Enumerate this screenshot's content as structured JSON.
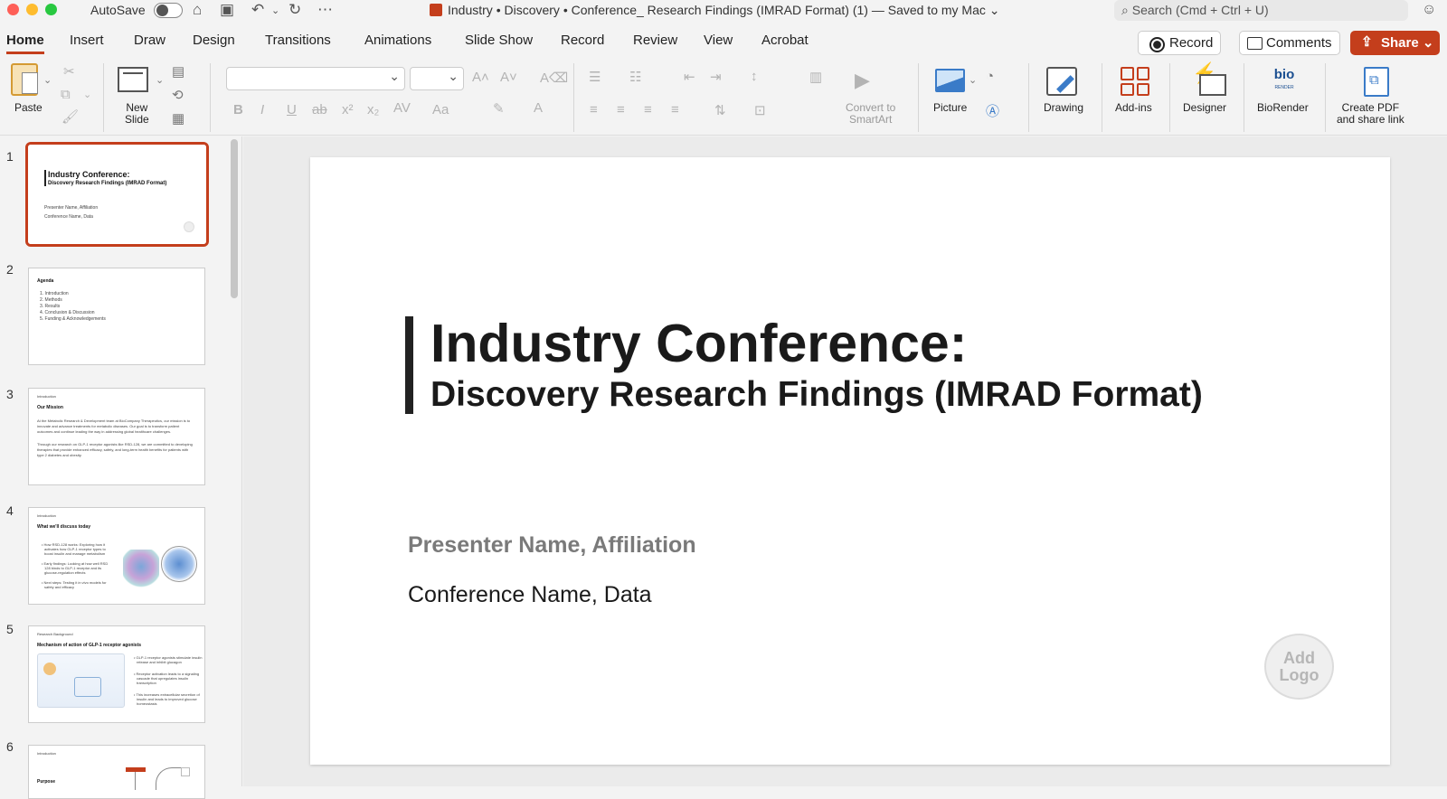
{
  "titlebar": {
    "autosave_label": "AutoSave",
    "document_title": "Industry • Discovery • Conference_ Research Findings (IMRAD Format) (1) — Saved to my Mac ⌄",
    "search_placeholder": "Search (Cmd + Ctrl + U)"
  },
  "tabs": [
    "Home",
    "Insert",
    "Draw",
    "Design",
    "Transitions",
    "Animations",
    "Slide Show",
    "Record",
    "Review",
    "View",
    "Acrobat"
  ],
  "header_buttons": {
    "record": "Record",
    "comments": "Comments",
    "share": "Share ⌄"
  },
  "ribbon": {
    "paste": "Paste",
    "new_slide": "New\nSlide",
    "convert_smartart": "Convert to\nSmartArt",
    "picture": "Picture",
    "drawing": "Drawing",
    "addins": "Add-ins",
    "designer": "Designer",
    "biorender": "BioRender",
    "biorender_mark": "bio",
    "biorender_mark_small": "RENDER",
    "create_pdf": "Create PDF\nand share link"
  },
  "thumbnails": [
    {
      "number": "1",
      "title": "Industry Conference:",
      "subtitle": "Discovery Research Findings (IMRAD Format)",
      "line1": "Presenter Name, Affiliation",
      "line2": "Conference Name, Data"
    },
    {
      "number": "2",
      "title": "Agenda",
      "items": [
        "1. Introduction",
        "2. Methods",
        "3. Results",
        "4. Conclusion & Discussion",
        "5. Funding & Acknowledgements"
      ]
    },
    {
      "number": "3",
      "section": "Introduction",
      "title": "Our Mission",
      "body1": "At the Metabolic Research & Development team at BioCompany Therapeutics, our mission is to",
      "body2": "innovate and advance treatments for metabolic diseases. Our goal is to transform patient",
      "body3": "outcomes and continue leading the way in addressing global healthcare challenges.",
      "body4": "Through our research on GLP-1 receptor agonists like RSD-128, we are committed to developing",
      "body5": "therapies that provide enhanced efficacy, safety, and long-term health benefits for patients with",
      "body6": "type 2 diabetes and obesity."
    },
    {
      "number": "4",
      "section": "Introduction",
      "title": "What we'll discuss today",
      "b1": "• How RSD-128 works: Exploring how it",
      "b1b": "activates how GLP-1 receptor types to",
      "b1c": "boost insulin and manage metabolism",
      "b2": "• Early findings: Looking at how well RSD",
      "b2b": "128 binds to GLP-1 receptor and its",
      "b2c": "glucose-regulation effects",
      "b3": "• Next steps: Testing it in vivo models for",
      "b3b": "safety and efficacy"
    },
    {
      "number": "5",
      "section": "Research Background",
      "title": "Mechanism of action of GLP-1 receptor agonists",
      "b1": "• GLP-1 receptor agonists stimulate insulin",
      "b1b": "release and inhibit glucagon",
      "b2": "• Receptor activation leads to a signaling",
      "b2b": "cascade that upregulates insulin",
      "b2c": "transcription",
      "b3": "• This increases extracellular secretion of",
      "b3b": "insulin and leads to improved glucose",
      "b3c": "homeostasis"
    },
    {
      "number": "6",
      "section": "Introduction",
      "title": "Purpose"
    }
  ],
  "slide": {
    "title": "Industry Conference:",
    "subtitle": "Discovery Research Findings (IMRAD Format)",
    "presenter": "Presenter Name, Affiliation",
    "conference": "Conference Name, Data",
    "logo_placeholder": "Add\nLogo"
  },
  "colors": {
    "accent": "#c43e1c",
    "title_text": "#1a1a1a",
    "presenter_text": "#7a7a7a"
  }
}
